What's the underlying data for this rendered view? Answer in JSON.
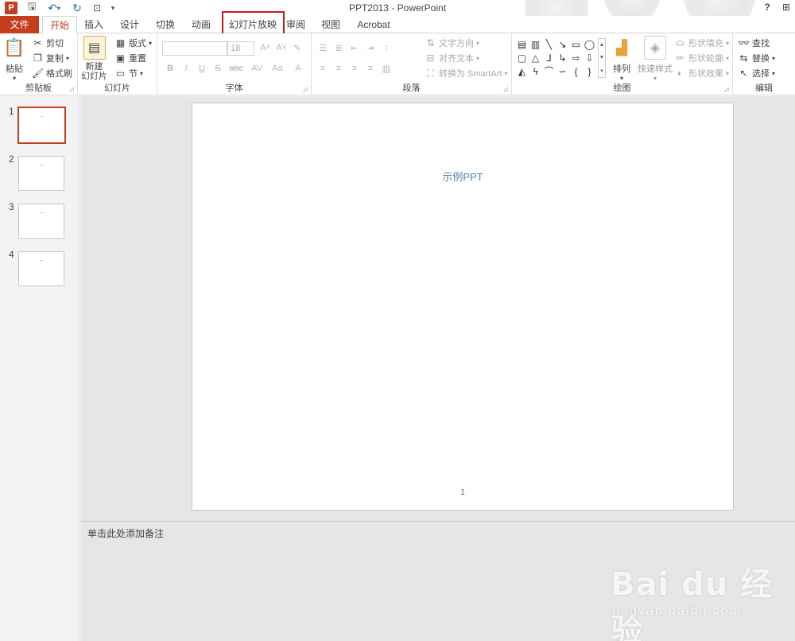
{
  "window": {
    "title": "PPT2013 - PowerPoint",
    "help": "?",
    "logo": "P"
  },
  "tabs": [
    "文件",
    "开始",
    "插入",
    "设计",
    "切换",
    "动画",
    "幻灯片放映",
    "审阅",
    "视图",
    "Acrobat"
  ],
  "highlight_color": "#d0161c",
  "accent_color": "#c43e1c",
  "ribbon": {
    "clipboard": {
      "label": "剪贴板",
      "paste": "粘贴",
      "cut": "剪切",
      "copy": "复制",
      "format_painter": "格式刷"
    },
    "slides": {
      "label": "幻灯片",
      "new_slide": "新建\n幻灯片",
      "layout": "版式",
      "reset": "重置",
      "section": "节"
    },
    "font": {
      "label": "字体",
      "font_name": "",
      "font_size": "18",
      "buttons": [
        "B",
        "I",
        "U",
        "S",
        "abc",
        "AV",
        "Aa",
        "A"
      ]
    },
    "paragraph": {
      "label": "段落",
      "text_direction": "文字方向",
      "align_text": "对齐文本",
      "convert_smartart": "转换为 SmartArt"
    },
    "drawing": {
      "label": "绘图",
      "arrange": "排列",
      "quick_styles": "快速样式",
      "shape_fill": "形状填充",
      "shape_outline": "形状轮廓",
      "shape_effects": "形状效果"
    },
    "editing": {
      "label": "编辑",
      "find": "查找",
      "replace": "替换",
      "select": "选择"
    }
  },
  "thumbnails": [
    {
      "number": "1",
      "selected": true
    },
    {
      "number": "2",
      "selected": false
    },
    {
      "number": "3",
      "selected": false
    },
    {
      "number": "4",
      "selected": false
    }
  ],
  "slide": {
    "title": "示例PPT",
    "number": "1"
  },
  "notes": {
    "placeholder": "单击此处添加备注"
  },
  "watermark": {
    "logo": "Bai du 经验",
    "url": "jingyan.baidu.com"
  }
}
